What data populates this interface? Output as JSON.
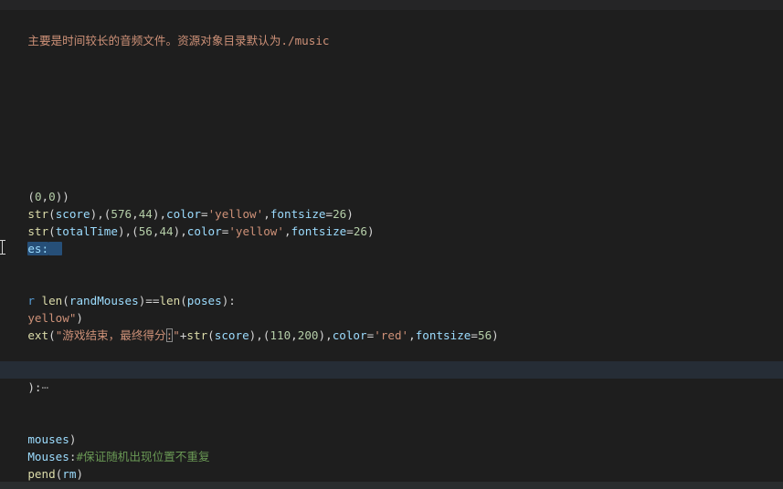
{
  "colors": {
    "background": "#1e1e1e",
    "selection": "#264f78",
    "current_line": "#262d36"
  },
  "lines": {
    "l0": [
      "主要是时间较长的音频文件。资源对象目录默认为./music"
    ],
    "l1": [
      "(",
      "0",
      ",",
      "0",
      "))"
    ],
    "l2": [
      "str",
      "(",
      "score",
      "),(",
      "576",
      ",",
      "44",
      "),",
      "color",
      "=",
      "'yellow'",
      ",",
      "fontsize",
      "=",
      "26",
      ")"
    ],
    "l3": [
      "str",
      "(",
      "totalTime",
      "),(",
      "56",
      ",",
      "44",
      "),",
      "color",
      "=",
      "'yellow'",
      ",",
      "fontsize",
      "=",
      "26",
      ")"
    ],
    "l4": [
      "es:"
    ],
    "l5": [
      "r ",
      "len",
      "(",
      "randMouses",
      ")==",
      "len",
      "(",
      "poses",
      "):"
    ],
    "l6": [
      "yellow\"",
      ")"
    ],
    "l7": [
      "ext",
      "(",
      "\"游戏结束，最终得分",
      ":",
      "\"",
      "+",
      "str",
      "(",
      "score",
      "),(",
      "110",
      ",",
      "200",
      "),",
      "color",
      "=",
      "'red'",
      ",",
      "fontsize",
      "=",
      "56",
      ")"
    ],
    "l8": [
      "):",
      "⋯"
    ],
    "l9": [
      "mouses",
      ")"
    ],
    "l10": [
      "Mouses",
      ":",
      "#保证随机出现位置不重复"
    ],
    "l11": [
      "pend",
      "(",
      "rm",
      ")"
    ]
  }
}
